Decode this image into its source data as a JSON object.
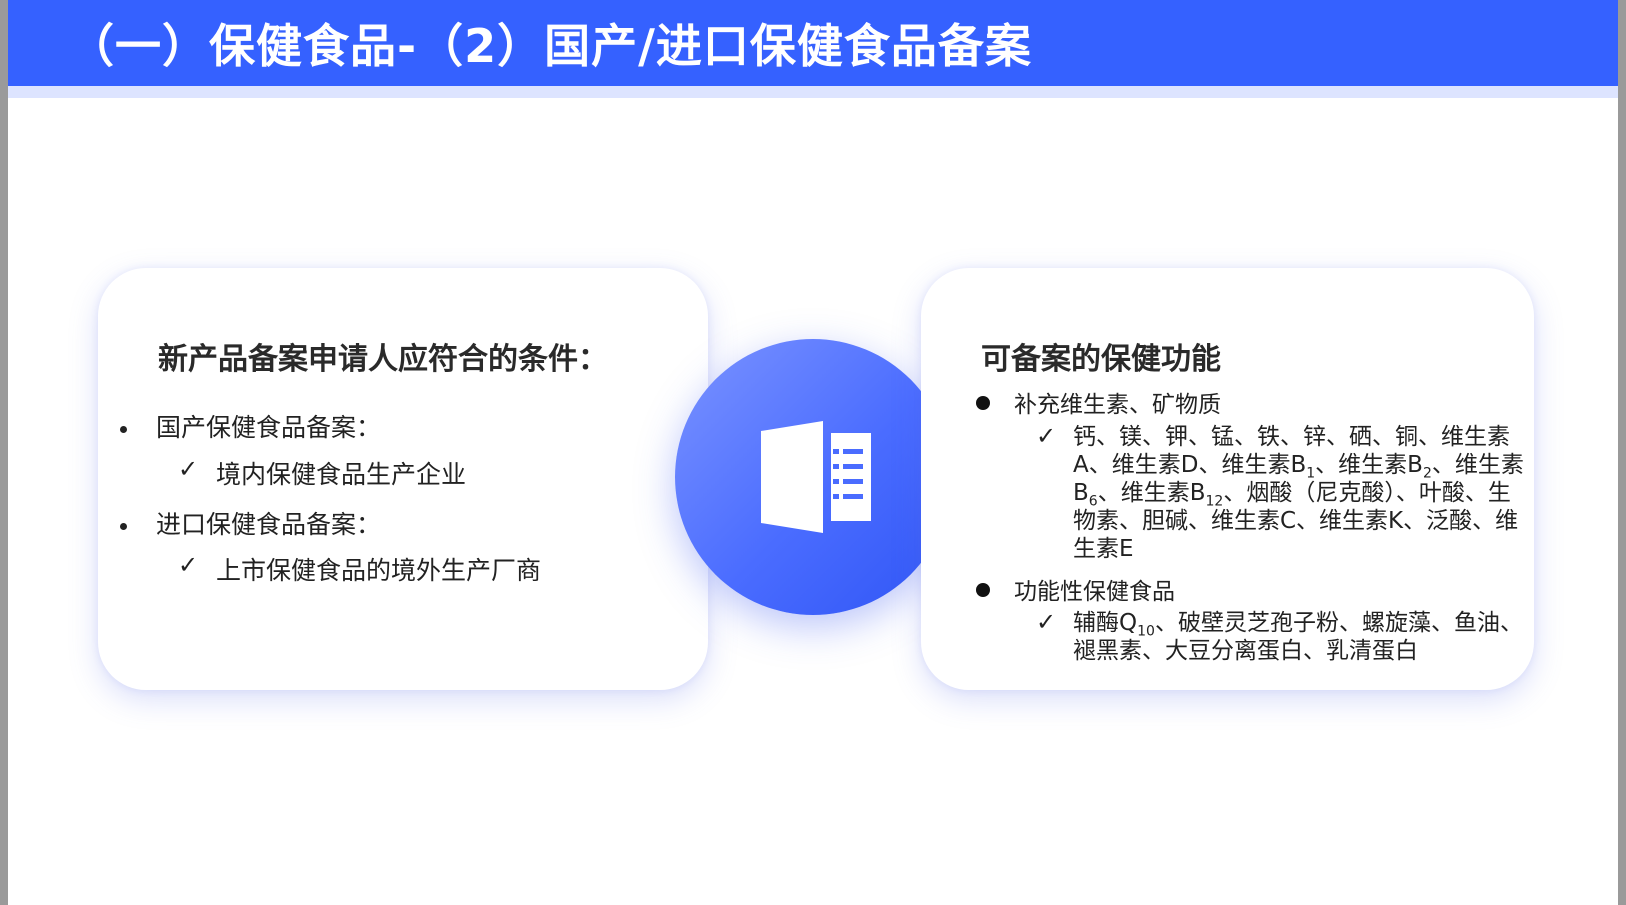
{
  "header": {
    "title": "（一）保健食品-（2）国产/进口保健食品备案"
  },
  "left_card": {
    "title": "新产品备案申请人应符合的条件：",
    "items": [
      {
        "label": "国产保健食品备案：",
        "sub": "境内保健食品生产企业"
      },
      {
        "label": "进口保健食品备案：",
        "sub": "上市保健食品的境外生产厂商"
      }
    ]
  },
  "center_icon": {
    "icon": "book-icon",
    "color": "#4a6cff"
  },
  "right_card": {
    "title": "可备案的保健功能",
    "items": [
      {
        "label": "补充维生素、矿物质",
        "text_parts": [
          "钙、镁、钾、锰、铁、锌、硒、铜、维生素A、维生素D、维生素B",
          "1",
          "、维生素B",
          "2",
          "、维生素B",
          "6",
          "、维生素B",
          "12",
          "、烟酸（尼克酸）、叶酸、生物素、胆碱、维生素C、维生素K、泛酸、维生素E"
        ]
      },
      {
        "label": "功能性保健食品",
        "text_parts": [
          "辅酶Q",
          "10",
          "、破壁灵芝孢子粉、螺旋藻、鱼油、褪黑素、大豆分离蛋白、乳清蛋白"
        ]
      }
    ]
  },
  "colors": {
    "header": "#3561ff",
    "accent": "#4a6cff"
  }
}
